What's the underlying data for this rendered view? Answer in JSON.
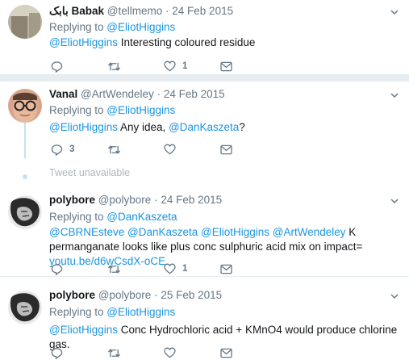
{
  "tweets": [
    {
      "name": "بابک Babak",
      "handle": "@tellmemo",
      "dot": "·",
      "date": "24 Feb 2015",
      "reply_prefix": "Replying to ",
      "reply_to": "@EliotHiggins",
      "body": [
        {
          "text": "@EliotHiggins",
          "link": true
        },
        {
          "text": " Interesting coloured residue",
          "link": false
        }
      ],
      "reply_count": "",
      "retweet_count": "",
      "like_count": "1"
    },
    {
      "name": "Vanal",
      "handle": "@ArtWendeley",
      "dot": "·",
      "date": "24 Feb 2015",
      "reply_prefix": "Replying to ",
      "reply_to": "@EliotHiggins",
      "body": [
        {
          "text": "@EliotHiggins",
          "link": true
        },
        {
          "text": " Any idea, ",
          "link": false
        },
        {
          "text": "@DanKaszeta",
          "link": true
        },
        {
          "text": "?",
          "link": false
        }
      ],
      "reply_count": "3",
      "retweet_count": "",
      "like_count": ""
    },
    {
      "name": "polybore",
      "handle": "@polybore",
      "dot": "·",
      "date": "24 Feb 2015",
      "reply_prefix": "Replying to ",
      "reply_to": "@DanKaszeta",
      "body": [
        {
          "text": "@CBRNEsteve",
          "link": true
        },
        {
          "text": " ",
          "link": false
        },
        {
          "text": "@DanKaszeta",
          "link": true
        },
        {
          "text": " ",
          "link": false
        },
        {
          "text": "@EliotHiggins",
          "link": true
        },
        {
          "text": " ",
          "link": false
        },
        {
          "text": "@ArtWendeley",
          "link": true
        },
        {
          "text": " K permanganate looks like plus conc sulphuric acid mix on impact= ",
          "link": false
        },
        {
          "text": "youtu.be/d6wCsdX-oCE",
          "link": true
        }
      ],
      "reply_count": "",
      "retweet_count": "",
      "like_count": "1"
    },
    {
      "name": "polybore",
      "handle": "@polybore",
      "dot": "·",
      "date": "25 Feb 2015",
      "reply_prefix": "Replying to ",
      "reply_to": "@EliotHiggins",
      "body": [
        {
          "text": "@EliotHiggins",
          "link": true
        },
        {
          "text": " Conc Hydrochloric acid + KMnO4 would produce chlorine gas.",
          "link": false
        }
      ],
      "reply_count": "",
      "retweet_count": "",
      "like_count": ""
    }
  ],
  "unavailable_text": "Tweet unavailable",
  "colors": {
    "link": "#1b95e0",
    "muted": "#657786",
    "thread": "#c4e0f5",
    "separator": "#e6ecf0"
  }
}
